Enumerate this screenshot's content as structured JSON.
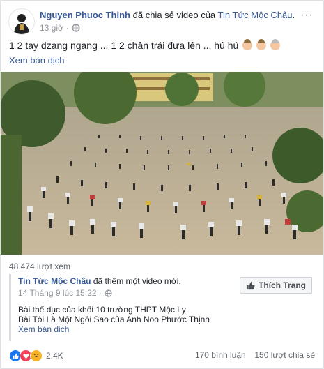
{
  "post": {
    "author": "Nguyen Phuoc Thinh",
    "action": "đã chia sẻ video của",
    "page": "Tin Tức Mộc Châu",
    "time": "13 giờ",
    "status_text": "1 2 tay dzang ngang ... 1 2 chân trái đưa lên ... hú hú",
    "translate": "Xem bản dịch",
    "more_icon": "···"
  },
  "video": {
    "views": "48.474 lượt xem"
  },
  "shared": {
    "page": "Tin Tức Mộc Châu",
    "action": "đã thêm một video mới.",
    "date": "14 Tháng 9 lúc 15:22 ·",
    "line1": "Bài thể dục của khối 10 trường THPT Mộc Lỵ",
    "line2": "Bài Tôi Là Một Ngôi Sao của Anh Noo Phước Thịnh",
    "translate": "Xem bản dịch",
    "like_label": "Thích Trang"
  },
  "footer": {
    "reactions_count": "2,4K",
    "comments": "170 bình luận",
    "shares": "150 lượt chia sẻ"
  },
  "colors": {
    "link": "#365899",
    "like_blue": "#1877f2",
    "heart": "#f33e58",
    "haha": "#f7b125"
  }
}
